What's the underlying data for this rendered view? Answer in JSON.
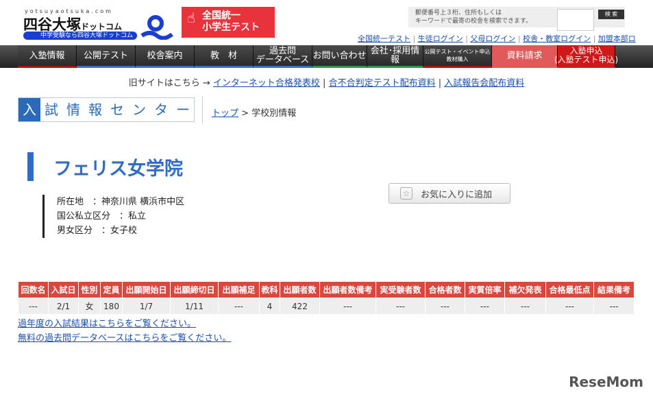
{
  "header": {
    "logo_url": "yotsuyaotsuka.com",
    "logo_main": "四谷大塚",
    "logo_main_suffix": "ドットコム",
    "logo_sub": "中学受験なら四谷大塚ドットコム",
    "banner": "全国統一\n小学生テスト",
    "search_hint_1": "郵便番号上３桁、住所もしくは",
    "search_hint_2": "キーワードで最寄の校舎を検索できます。",
    "search_button": "検 索",
    "top_links": [
      "全国統一テスト",
      "生徒ログイン",
      "父母ログイン",
      "校舎・教室ログイン",
      "加盟本部ロ"
    ]
  },
  "nav": [
    {
      "label": "入塾情報"
    },
    {
      "label": "公開テスト"
    },
    {
      "label": "校舎案内"
    },
    {
      "label": "教　材"
    },
    {
      "label": "過去問\nデータベース"
    },
    {
      "label": "お問い合わせ"
    },
    {
      "label": "会社･採用情報"
    },
    {
      "label": "公開テスト・イベント申込\n教材購入"
    },
    {
      "label": "資料請求"
    },
    {
      "label": "入塾申込\n(入塾テスト申込)"
    }
  ],
  "oldsite": {
    "prefix": "旧サイトはこちら → ",
    "links": [
      "インターネット合格発表校",
      "合不合判定テスト配布資料",
      "入試報告会配布資料"
    ]
  },
  "center": {
    "title_chars": [
      "入",
      "試",
      "情",
      "報",
      "セ",
      "ン",
      "タ",
      "ー"
    ]
  },
  "breadcrumb": {
    "home": "トップ",
    "sep": " > ",
    "current": "学校別情報"
  },
  "school": {
    "name": "フェリス女学院",
    "location": "所在地　：神奈川県 横浜市中区",
    "type": "国公私立区分　：私立",
    "gender": "男女区分　：女子校"
  },
  "favorite_label": "お気に入りに追加",
  "table": {
    "headers": [
      "回数名",
      "入試日",
      "性別",
      "定員",
      "出願開始日",
      "出願締切日",
      "出願補足",
      "教科",
      "出願者数",
      "出願者数備考",
      "実受験者数",
      "合格者数",
      "実質倍率",
      "補欠発表",
      "合格最低点",
      "結果備考"
    ],
    "rows": [
      [
        "---",
        "2/1",
        "女",
        "180",
        "1/7",
        "1/11",
        "---",
        "4",
        "422",
        "---",
        "---",
        "---",
        "---",
        "---",
        "---",
        "---"
      ]
    ]
  },
  "links": {
    "past_results": "過年度の入試結果はこちらをご覧ください。",
    "free_db": "無料の過去問データベースはこちらをご覧ください。"
  },
  "watermark": "ReseMom"
}
